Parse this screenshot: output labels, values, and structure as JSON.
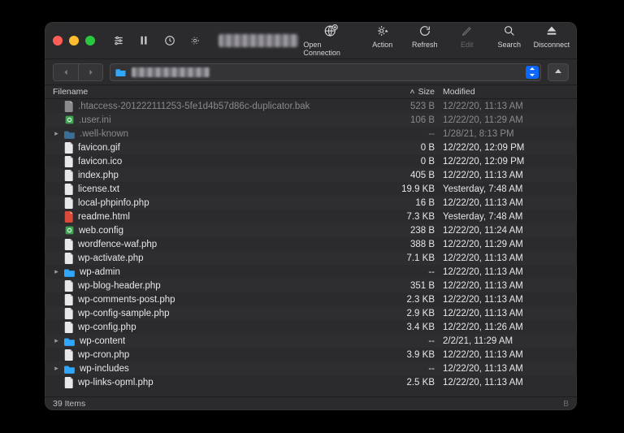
{
  "toolbar": {
    "open_connection": "Open Connection",
    "action": "Action",
    "refresh": "Refresh",
    "edit": "Edit",
    "search": "Search",
    "disconnect": "Disconnect"
  },
  "columns": {
    "filename": "Filename",
    "size": "Size",
    "modified": "Modified"
  },
  "footer": {
    "count_label": "39 Items",
    "corner": "B"
  },
  "rows": [
    {
      "name": ".htaccess-201222111253-5fe1d4b57d86c-duplicator.bak",
      "size": "523 B",
      "mod": "12/22/20, 11:13 AM",
      "icon": "file",
      "dim": true
    },
    {
      "name": ".user.ini",
      "size": "106 B",
      "mod": "12/22/20, 11:29 AM",
      "icon": "gear",
      "dim": true
    },
    {
      "name": ".well-known",
      "size": "--",
      "mod": "1/28/21, 8:13 PM",
      "icon": "folder",
      "dim": true,
      "expandable": true
    },
    {
      "name": "favicon.gif",
      "size": "0 B",
      "mod": "12/22/20, 12:09 PM",
      "icon": "file"
    },
    {
      "name": "favicon.ico",
      "size": "0 B",
      "mod": "12/22/20, 12:09 PM",
      "icon": "file"
    },
    {
      "name": "index.php",
      "size": "405 B",
      "mod": "12/22/20, 11:13 AM",
      "icon": "file"
    },
    {
      "name": "license.txt",
      "size": "19.9 KB",
      "mod": "Yesterday, 7:48 AM",
      "icon": "file"
    },
    {
      "name": "local-phpinfo.php",
      "size": "16 B",
      "mod": "12/22/20, 11:13 AM",
      "icon": "file"
    },
    {
      "name": "readme.html",
      "size": "7.3 KB",
      "mod": "Yesterday, 7:48 AM",
      "icon": "html"
    },
    {
      "name": "web.config",
      "size": "238 B",
      "mod": "12/22/20, 11:24 AM",
      "icon": "gear"
    },
    {
      "name": "wordfence-waf.php",
      "size": "388 B",
      "mod": "12/22/20, 11:29 AM",
      "icon": "file"
    },
    {
      "name": "wp-activate.php",
      "size": "7.1 KB",
      "mod": "12/22/20, 11:13 AM",
      "icon": "file"
    },
    {
      "name": "wp-admin",
      "size": "--",
      "mod": "12/22/20, 11:13 AM",
      "icon": "folder",
      "expandable": true
    },
    {
      "name": "wp-blog-header.php",
      "size": "351 B",
      "mod": "12/22/20, 11:13 AM",
      "icon": "file"
    },
    {
      "name": "wp-comments-post.php",
      "size": "2.3 KB",
      "mod": "12/22/20, 11:13 AM",
      "icon": "file"
    },
    {
      "name": "wp-config-sample.php",
      "size": "2.9 KB",
      "mod": "12/22/20, 11:13 AM",
      "icon": "file"
    },
    {
      "name": "wp-config.php",
      "size": "3.4 KB",
      "mod": "12/22/20, 11:26 AM",
      "icon": "file"
    },
    {
      "name": "wp-content",
      "size": "--",
      "mod": "2/2/21, 11:29 AM",
      "icon": "folder",
      "expandable": true
    },
    {
      "name": "wp-cron.php",
      "size": "3.9 KB",
      "mod": "12/22/20, 11:13 AM",
      "icon": "file"
    },
    {
      "name": "wp-includes",
      "size": "--",
      "mod": "12/22/20, 11:13 AM",
      "icon": "folder",
      "expandable": true
    },
    {
      "name": "wp-links-opml.php",
      "size": "2.5 KB",
      "mod": "12/22/20, 11:13 AM",
      "icon": "file"
    }
  ]
}
